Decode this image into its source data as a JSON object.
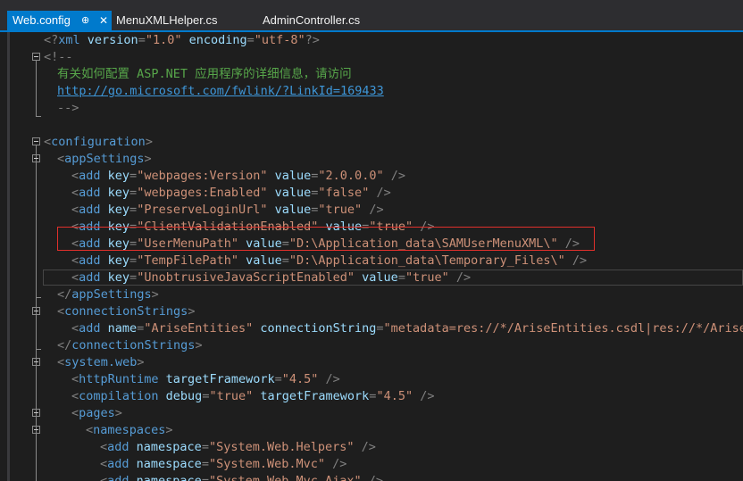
{
  "tabs": [
    {
      "label": "Web.config",
      "pin_glyph": "⊕",
      "close_glyph": "✕"
    },
    {
      "label": "MenuXMLHelper.cs"
    },
    {
      "label": "AdminController.cs"
    }
  ],
  "colors": {
    "tab_active": "#007acc",
    "editor_bg": "#1e1e1e",
    "element": "#569cd6",
    "attribute": "#9cdcfe",
    "value": "#ce9178",
    "comment": "#57a64a",
    "highlight_box": "#e0302b"
  },
  "code": {
    "l0": {
      "b1": "<?",
      "n": "xml",
      "a1": " version",
      "e1": "=",
      "v1": "\"1.0\"",
      "a2": " encoding",
      "e2": "=",
      "v2": "\"utf-8\"",
      "b2": "?>"
    },
    "l1": {
      "b": "<!--"
    },
    "l2": {
      "c": "有关如何配置 ASP.NET 应用程序的详细信息，请访问"
    },
    "l3": {
      "link": "http://go.microsoft.com/fwlink/?LinkId=169433"
    },
    "l4": {
      "b": "-->"
    },
    "l6": {
      "b1": "<",
      "n": "configuration",
      "b2": ">"
    },
    "l7": {
      "b1": "<",
      "n": "appSettings",
      "b2": ">"
    },
    "l8": {
      "b1": "<",
      "n": "add",
      "a1": " key",
      "e1": "=",
      "v1": "\"webpages:Version\"",
      "a2": " value",
      "e2": "=",
      "v2": "\"2.0.0.0\"",
      "b2": " />"
    },
    "l9": {
      "b1": "<",
      "n": "add",
      "a1": " key",
      "e1": "=",
      "v1": "\"webpages:Enabled\"",
      "a2": " value",
      "e2": "=",
      "v2": "\"false\"",
      "b2": " />"
    },
    "l10": {
      "b1": "<",
      "n": "add",
      "a1": " key",
      "e1": "=",
      "v1": "\"PreserveLoginUrl\"",
      "a2": " value",
      "e2": "=",
      "v2": "\"true\"",
      "b2": " />"
    },
    "l11": {
      "b1": "<",
      "n": "add",
      "a1": " key",
      "e1": "=",
      "v1": "\"ClientValidationEnabled\"",
      "a2": " value",
      "e2": "=",
      "v2": "\"true\"",
      "b2": " />"
    },
    "l12": {
      "b1": "<",
      "n": "add",
      "a1": " key",
      "e1": "=",
      "v1": "\"UserMenuPath\"",
      "a2": " value",
      "e2": "=",
      "v2": "\"D:\\Application_data\\SAMUserMenuXML\\\"",
      "b2": " />"
    },
    "l13": {
      "b1": "<",
      "n": "add",
      "a1": " key",
      "e1": "=",
      "v1": "\"TempFilePath\"",
      "a2": " value",
      "e2": "=",
      "v2": "\"D:\\Application_data\\Temporary_Files\\\"",
      "b2": " />"
    },
    "l14": {
      "b1": "<",
      "n": "add",
      "a1": " key",
      "e1": "=",
      "v1": "\"UnobtrusiveJavaScriptEnabled\"",
      "a2": " value",
      "e2": "=",
      "v2": "\"true\"",
      "b2": " />"
    },
    "l15": {
      "b1": "</",
      "n": "appSettings",
      "b2": ">"
    },
    "l16": {
      "b1": "<",
      "n": "connectionStrings",
      "b2": ">"
    },
    "l17": {
      "b1": "<",
      "n": "add",
      "a1": " name",
      "e1": "=",
      "v1": "\"AriseEntities\"",
      "a2": " connectionString",
      "e2": "=",
      "v2": "\"metadata=res://*/AriseEntities.csdl|res://*/AriseE"
    },
    "l18": {
      "b1": "</",
      "n": "connectionStrings",
      "b2": ">"
    },
    "l19": {
      "b1": "<",
      "n": "system.web",
      "b2": ">"
    },
    "l20": {
      "b1": "<",
      "n": "httpRuntime",
      "a1": " targetFramework",
      "e1": "=",
      "v1": "\"4.5\"",
      "b2": " />"
    },
    "l21": {
      "b1": "<",
      "n": "compilation",
      "a1": " debug",
      "e1": "=",
      "v1": "\"true\"",
      "a2": " targetFramework",
      "e2": "=",
      "v2": "\"4.5\"",
      "b2": " />"
    },
    "l22": {
      "b1": "<",
      "n": "pages",
      "b2": ">"
    },
    "l23": {
      "b1": "<",
      "n": "namespaces",
      "b2": ">"
    },
    "l24": {
      "b1": "<",
      "n": "add",
      "a1": " namespace",
      "e1": "=",
      "v1": "\"System.Web.Helpers\"",
      "b2": " />"
    },
    "l25": {
      "b1": "<",
      "n": "add",
      "a1": " namespace",
      "e1": "=",
      "v1": "\"System.Web.Mvc\"",
      "b2": " />"
    },
    "l26": {
      "b1": "<",
      "n": "add",
      "a1": " namespace",
      "e1": "=",
      "v1": "\"System.Web.Mvc.Ajax\"",
      "b2": " />"
    }
  }
}
